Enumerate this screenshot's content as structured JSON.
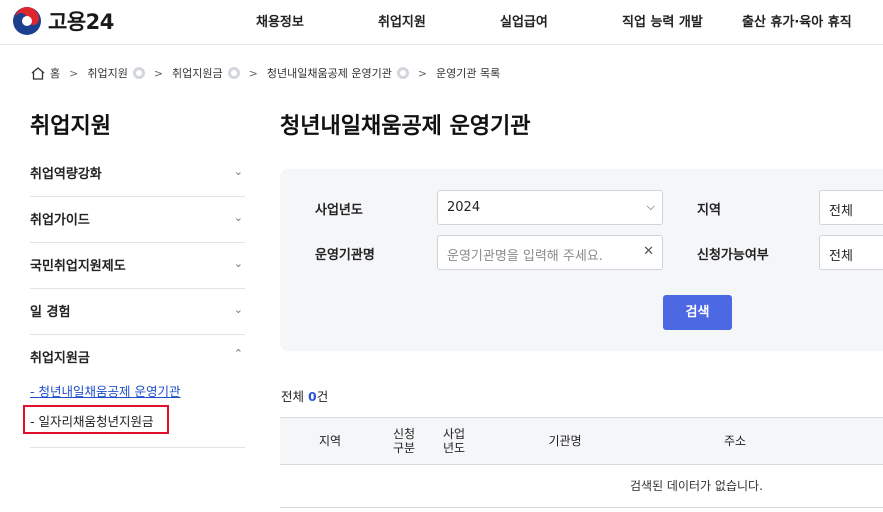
{
  "header": {
    "logo_text": "고용24",
    "nav": [
      "채용정보",
      "취업지원",
      "실업급여",
      "직업 능력 개발",
      "출산 휴가·육아 휴직"
    ]
  },
  "breadcrumb": {
    "home": "홈",
    "items": [
      "취업지원",
      "취업지원금",
      "청년내일채움공제 운영기관",
      "운영기관 목록"
    ]
  },
  "sidebar": {
    "title": "취업지원",
    "items": [
      {
        "label": "취업역량강화",
        "state": "collapsed"
      },
      {
        "label": "취업가이드",
        "state": "collapsed"
      },
      {
        "label": "국민취업지원제도",
        "state": "collapsed"
      },
      {
        "label": "일 경험",
        "state": "collapsed"
      },
      {
        "label": "취업지원금",
        "state": "expanded"
      }
    ],
    "sub_items": [
      "- 청년내일채움공제 운영기관",
      "- 일자리채움청년지원금"
    ]
  },
  "main": {
    "title": "청년내일채움공제 운영기관",
    "search": {
      "year_label": "사업년도",
      "year_value": "2024",
      "region_label": "지역",
      "region_value": "전체",
      "org_label": "운영기관명",
      "org_placeholder": "운영기관명을 입력해 주세요.",
      "apply_label": "신청가능여부",
      "apply_value": "전체",
      "search_button": "검색"
    },
    "total_prefix": "전체 ",
    "total_count": "0",
    "total_suffix": "건",
    "table": {
      "headers": [
        "지역",
        "신청\n구분",
        "사업\n년도",
        "기관명",
        "주소"
      ],
      "empty_message": "검색된 데이터가 없습니다."
    }
  },
  "colors": {
    "accent": "#4d68e3",
    "link": "#1e4fc9",
    "highlight_box": "#e0102a",
    "panel_bg": "#f5f6f8"
  }
}
